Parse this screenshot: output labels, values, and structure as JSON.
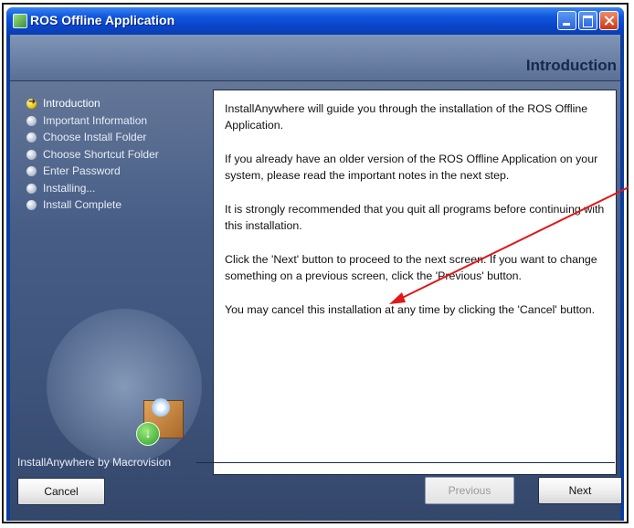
{
  "window": {
    "title": "ROS Offline Application",
    "icon": "app-icon"
  },
  "titlebar_buttons": [
    "minimize-icon",
    "maximize-icon",
    "close-icon"
  ],
  "header": {
    "page_heading": "Introduction"
  },
  "steps": [
    {
      "label": "Introduction",
      "state": "current"
    },
    {
      "label": "Important Information",
      "state": "pending"
    },
    {
      "label": "Choose Install Folder",
      "state": "pending"
    },
    {
      "label": "Choose Shortcut Folder",
      "state": "pending"
    },
    {
      "label": "Enter Password",
      "state": "pending"
    },
    {
      "label": "Installing...",
      "state": "pending"
    },
    {
      "label": "Install Complete",
      "state": "pending"
    }
  ],
  "content": {
    "paragraphs": [
      "InstallAnywhere will guide you through the installation of the ROS Offline Application.",
      "If you already have an older version of the ROS Offline Application on your system, please read the important notes in the next step.",
      "It is strongly recommended that you quit all programs before continuing with this installation.",
      "Click the 'Next' button to proceed to the next screen. If you want to change something on a previous screen, click the 'Previous' button.",
      "You may cancel this installation at any time by clicking the 'Cancel' button."
    ]
  },
  "footer": {
    "brand": "InstallAnywhere by Macrovision"
  },
  "buttons": {
    "cancel": "Cancel",
    "previous": "Previous",
    "next": "Next",
    "previous_enabled": false
  },
  "colors": {
    "title_bar": "#0a45c8",
    "panel_bg": "#475d86",
    "annotation_arrow": "#e01818",
    "current_step": "#f2c400"
  }
}
